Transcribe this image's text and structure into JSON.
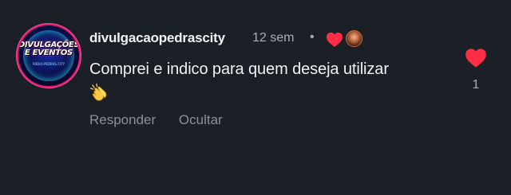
{
  "comment": {
    "avatar_text_line1": "DIVULGAÇÕES",
    "avatar_text_line2": "E EVENTOS",
    "avatar_sub": "RÁDIO PEDRAS CITY",
    "username": "divulgacaopedrascity",
    "time": "12 sem",
    "separator": "•",
    "text": "Comprei e indico para quem deseja utilizar",
    "emoji": "clapping-hands-emoji",
    "actions": {
      "reply": "Responder",
      "hide": "Ocultar"
    },
    "like_count": "1"
  },
  "colors": {
    "background": "#1b1f26",
    "heart": "#ff2d45",
    "secondary_text": "#a9adb4",
    "action_text": "#8b9097"
  }
}
